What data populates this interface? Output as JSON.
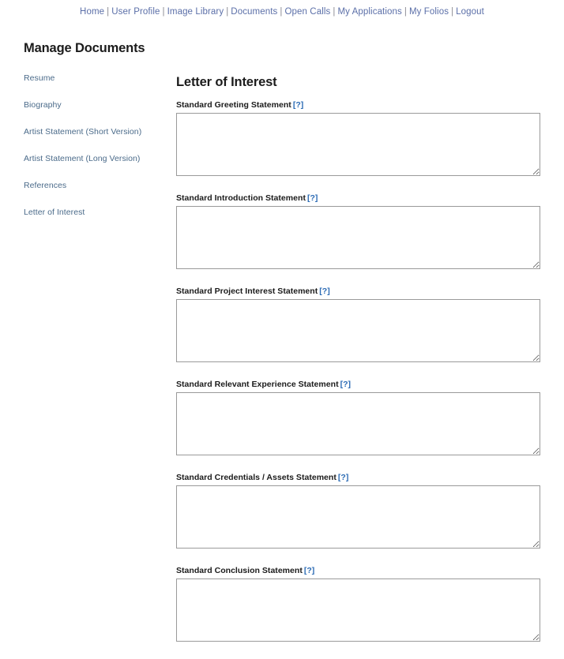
{
  "topnav": {
    "separator": "|",
    "items": [
      {
        "label": "Home"
      },
      {
        "label": "User Profile"
      },
      {
        "label": "Image Library"
      },
      {
        "label": "Documents"
      },
      {
        "label": "Open Calls"
      },
      {
        "label": "My Applications"
      },
      {
        "label": "My Folios"
      },
      {
        "label": "Logout"
      }
    ]
  },
  "sidebar": {
    "title": "Manage Documents",
    "items": [
      {
        "label": "Resume"
      },
      {
        "label": "Biography"
      },
      {
        "label": "Artist Statement (Short Version)"
      },
      {
        "label": "Artist Statement (Long Version)"
      },
      {
        "label": "References"
      },
      {
        "label": "Letter of Interest"
      }
    ]
  },
  "main": {
    "title": "Letter of Interest",
    "help_label": "[?]",
    "fields": [
      {
        "label": "Standard Greeting Statement",
        "value": "",
        "placeholder": ""
      },
      {
        "label": "Standard Introduction Statement",
        "value": "",
        "placeholder": ""
      },
      {
        "label": "Standard Project Interest Statement",
        "value": "",
        "placeholder": ""
      },
      {
        "label": "Standard Relevant Experience Statement",
        "value": "",
        "placeholder": ""
      },
      {
        "label": "Standard Credentials / Assets Statement",
        "value": "",
        "placeholder": ""
      },
      {
        "label": "Standard Conclusion Statement",
        "value": "",
        "placeholder": ""
      }
    ]
  },
  "colors": {
    "nav_link": "#5b6fa8",
    "sidebar_link": "#4b6b8a",
    "help_link": "#2d6cb5",
    "heading": "#1b1b1b",
    "input_border": "#9a9a9a",
    "background": "#ffffff"
  }
}
